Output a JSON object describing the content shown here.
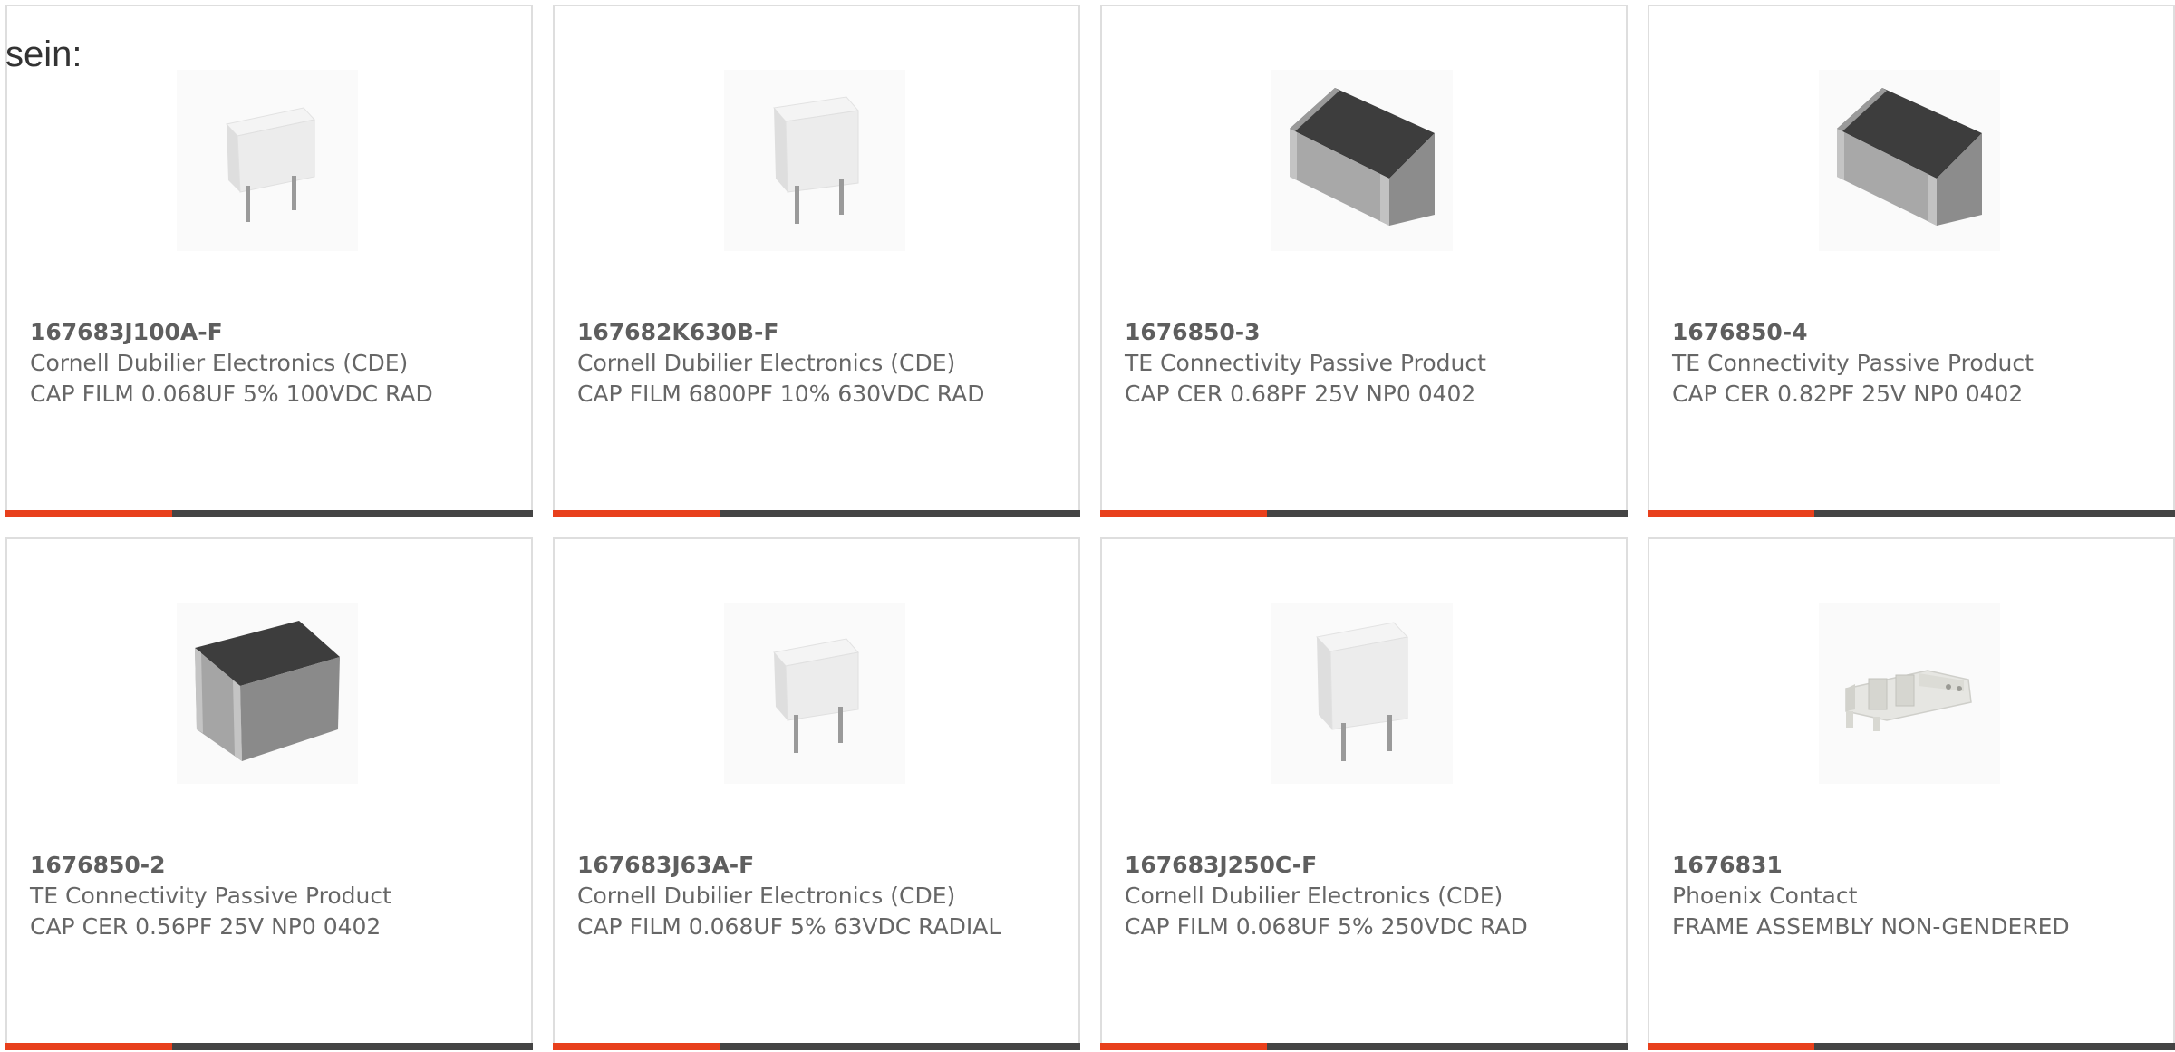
{
  "intro_text": "sein:",
  "accent_color": "#e8401c",
  "bar_color": "#444444",
  "products": [
    {
      "part_number": "167683J100A-F",
      "manufacturer": "Cornell Dubilier Electronics (CDE)",
      "description": "CAP FILM 0.068UF 5% 100VDC RAD",
      "image_icon": "film-capacitor-icon"
    },
    {
      "part_number": "167682K630B-F",
      "manufacturer": "Cornell Dubilier Electronics (CDE)",
      "description": "CAP FILM 6800PF 10% 630VDC RAD",
      "image_icon": "film-capacitor-icon"
    },
    {
      "part_number": "1676850-3",
      "manufacturer": "TE Connectivity Passive Product",
      "description": "CAP CER 0.68PF 25V NP0 0402",
      "image_icon": "chip-capacitor-icon"
    },
    {
      "part_number": "1676850-4",
      "manufacturer": "TE Connectivity Passive Product",
      "description": "CAP CER 0.82PF 25V NP0 0402",
      "image_icon": "chip-capacitor-icon"
    },
    {
      "part_number": "1676850-2",
      "manufacturer": "TE Connectivity Passive Product",
      "description": "CAP CER 0.56PF 25V NP0 0402",
      "image_icon": "chip-capacitor-icon"
    },
    {
      "part_number": "167683J63A-F",
      "manufacturer": "Cornell Dubilier Electronics (CDE)",
      "description": "CAP FILM 0.068UF 5% 63VDC RADIAL",
      "image_icon": "film-capacitor-icon"
    },
    {
      "part_number": "167683J250C-F",
      "manufacturer": "Cornell Dubilier Electronics (CDE)",
      "description": "CAP FILM 0.068UF 5% 250VDC RAD",
      "image_icon": "film-capacitor-icon"
    },
    {
      "part_number": "1676831",
      "manufacturer": "Phoenix Contact",
      "description": "FRAME ASSEMBLY NON-GENDERED",
      "image_icon": "frame-assembly-icon"
    }
  ]
}
